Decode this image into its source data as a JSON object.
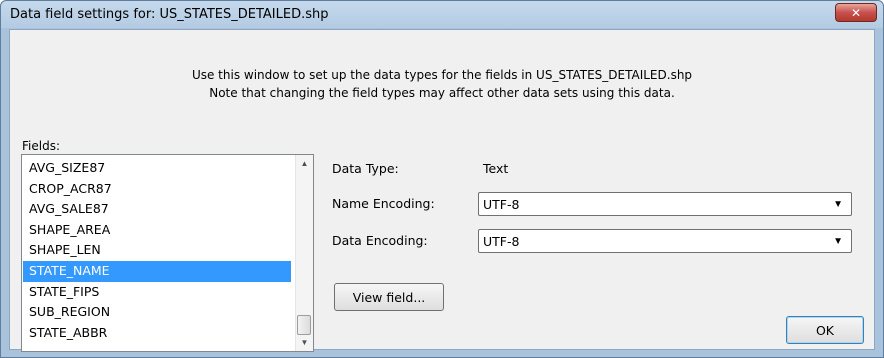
{
  "window": {
    "title": "Data field settings for: US_STATES_DETAILED.shp",
    "close_glyph": "✕"
  },
  "intro": {
    "line1": "Use this window to set up the data types for the fields in US_STATES_DETAILED.shp",
    "line2": "Note that changing the field types may affect other data sets using this data."
  },
  "fields": {
    "label": "Fields:",
    "items": [
      {
        "label": "AVG_SIZE87"
      },
      {
        "label": "CROP_ACR87"
      },
      {
        "label": "AVG_SALE87"
      },
      {
        "label": "SHAPE_AREA"
      },
      {
        "label": "SHAPE_LEN"
      },
      {
        "label": "STATE_NAME"
      },
      {
        "label": "STATE_FIPS"
      },
      {
        "label": "SUB_REGION"
      },
      {
        "label": "STATE_ABBR"
      }
    ],
    "selected": "STATE_NAME",
    "scroll_up_glyph": "▲",
    "scroll_down_glyph": "▼"
  },
  "data_type": {
    "label": "Data Type:",
    "value": "Text"
  },
  "name_encoding": {
    "label": "Name Encoding:",
    "value": "UTF-8",
    "arrow_glyph": "▼"
  },
  "data_encoding": {
    "label": "Data Encoding:",
    "value": "UTF-8",
    "arrow_glyph": "▼"
  },
  "buttons": {
    "view_field": "View field...",
    "ok": "OK"
  },
  "colors": {
    "selection": "#3399ff",
    "close_button": "#c75050",
    "frame": "#a9c3dd"
  }
}
